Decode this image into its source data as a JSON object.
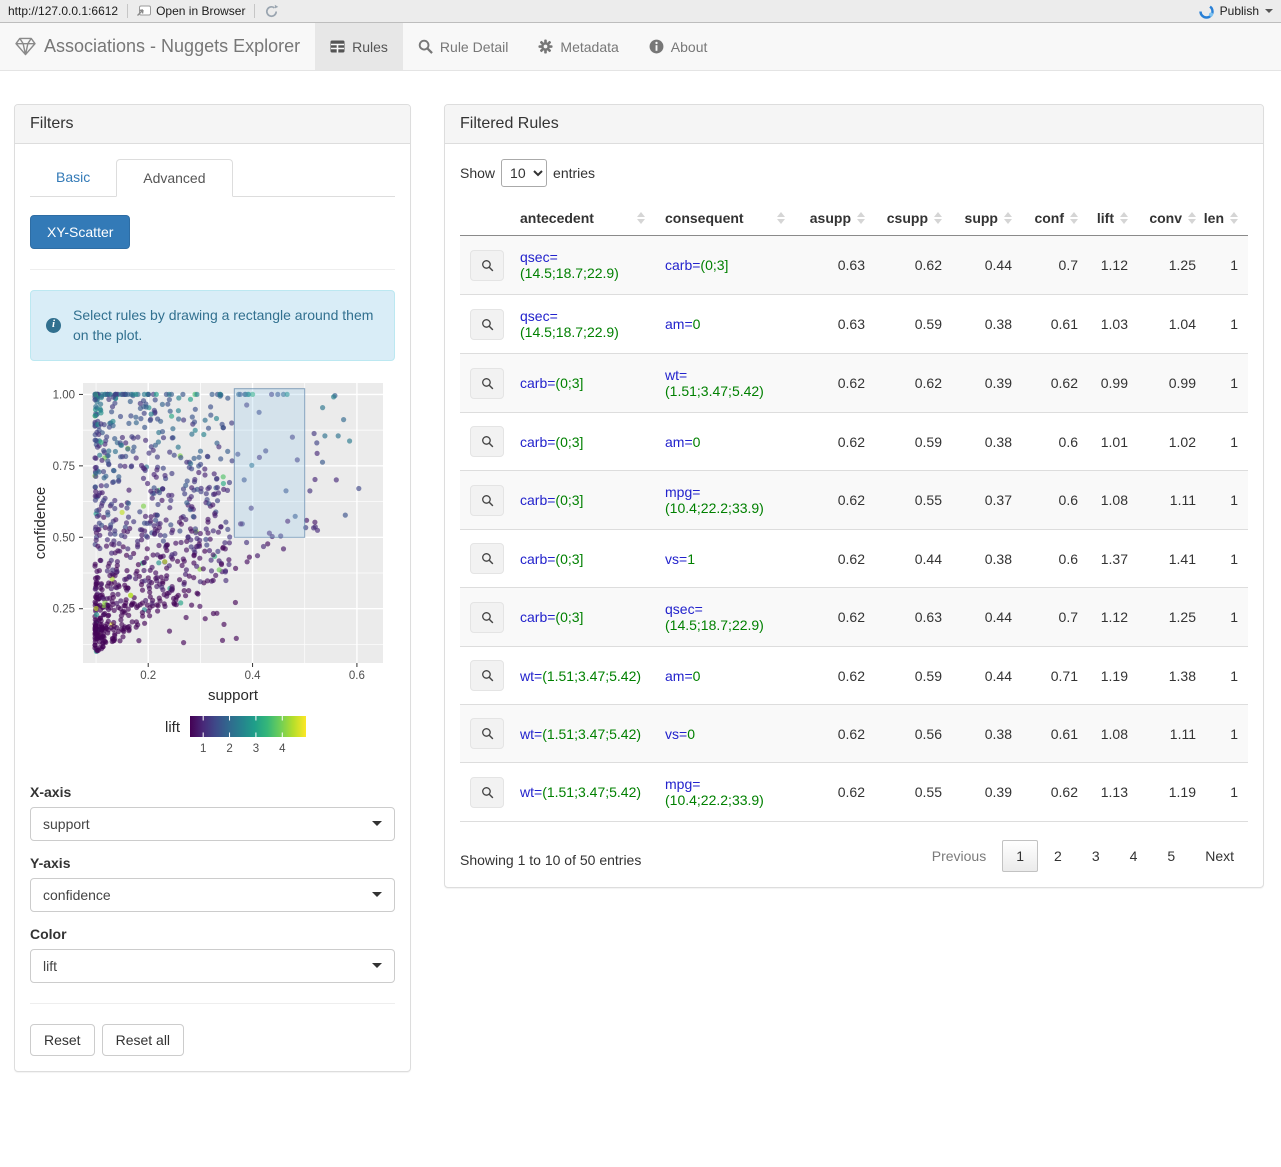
{
  "viewer_toolbar": {
    "url": "http://127.0.0.1:6612",
    "open_in_browser_label": "Open in Browser",
    "publish_label": "Publish"
  },
  "navbar": {
    "brand": "Associations - Nuggets Explorer",
    "tabs": [
      {
        "label": "Rules",
        "icon": "table-icon",
        "active": true
      },
      {
        "label": "Rule Detail",
        "icon": "search-icon",
        "active": false
      },
      {
        "label": "Metadata",
        "icon": "gear-icon",
        "active": false
      },
      {
        "label": "About",
        "icon": "info-icon",
        "active": false
      }
    ]
  },
  "filters_panel": {
    "title": "Filters",
    "tabs": [
      {
        "label": "Basic",
        "active": false
      },
      {
        "label": "Advanced",
        "active": true
      }
    ],
    "scatter_button_label": "XY-Scatter",
    "info_alert": "Select rules by drawing a rectangle around them on the plot.",
    "x_axis": {
      "label": "X-axis",
      "value": "support"
    },
    "y_axis": {
      "label": "Y-axis",
      "value": "confidence"
    },
    "color": {
      "label": "Color",
      "value": "lift"
    },
    "reset_label": "Reset",
    "reset_all_label": "Reset all"
  },
  "rules_panel": {
    "title": "Filtered Rules",
    "show_label": "Show",
    "entries_label": "entries",
    "page_length": "10",
    "columns": [
      {
        "label": "",
        "sortable": false,
        "align": "left"
      },
      {
        "label": "antecedent",
        "sortable": true,
        "align": "left"
      },
      {
        "label": "consequent",
        "sortable": true,
        "align": "left"
      },
      {
        "label": "asupp",
        "sortable": true,
        "align": "right"
      },
      {
        "label": "csupp",
        "sortable": true,
        "align": "right"
      },
      {
        "label": "supp",
        "sortable": true,
        "align": "right"
      },
      {
        "label": "conf",
        "sortable": true,
        "align": "right"
      },
      {
        "label": "lift",
        "sortable": true,
        "align": "right"
      },
      {
        "label": "conv",
        "sortable": true,
        "align": "right"
      },
      {
        "label": "len",
        "sortable": true,
        "align": "right"
      }
    ],
    "rows": [
      {
        "antecedent": {
          "attr": "qsec=",
          "value": "(14.5;18.7;22.9)"
        },
        "consequent": {
          "attr": "carb=",
          "value": "(0;3]"
        },
        "asupp": "0.63",
        "csupp": "0.62",
        "supp": "0.44",
        "conf": "0.7",
        "lift": "1.12",
        "conv": "1.25",
        "len": "1"
      },
      {
        "antecedent": {
          "attr": "qsec=",
          "value": "(14.5;18.7;22.9)"
        },
        "consequent": {
          "attr": "am=",
          "value": "0"
        },
        "asupp": "0.63",
        "csupp": "0.59",
        "supp": "0.38",
        "conf": "0.61",
        "lift": "1.03",
        "conv": "1.04",
        "len": "1"
      },
      {
        "antecedent": {
          "attr": "carb=",
          "value": "(0;3]"
        },
        "consequent": {
          "attr": "wt=",
          "value": "(1.51;3.47;5.42)"
        },
        "asupp": "0.62",
        "csupp": "0.62",
        "supp": "0.39",
        "conf": "0.62",
        "lift": "0.99",
        "conv": "0.99",
        "len": "1"
      },
      {
        "antecedent": {
          "attr": "carb=",
          "value": "(0;3]"
        },
        "consequent": {
          "attr": "am=",
          "value": "0"
        },
        "asupp": "0.62",
        "csupp": "0.59",
        "supp": "0.38",
        "conf": "0.6",
        "lift": "1.01",
        "conv": "1.02",
        "len": "1"
      },
      {
        "antecedent": {
          "attr": "carb=",
          "value": "(0;3]"
        },
        "consequent": {
          "attr": "mpg=",
          "value": "(10.4;22.2;33.9)"
        },
        "asupp": "0.62",
        "csupp": "0.55",
        "supp": "0.37",
        "conf": "0.6",
        "lift": "1.08",
        "conv": "1.11",
        "len": "1"
      },
      {
        "antecedent": {
          "attr": "carb=",
          "value": "(0;3]"
        },
        "consequent": {
          "attr": "vs=",
          "value": "1"
        },
        "asupp": "0.62",
        "csupp": "0.44",
        "supp": "0.38",
        "conf": "0.6",
        "lift": "1.37",
        "conv": "1.41",
        "len": "1"
      },
      {
        "antecedent": {
          "attr": "carb=",
          "value": "(0;3]"
        },
        "consequent": {
          "attr": "qsec=",
          "value": "(14.5;18.7;22.9)"
        },
        "asupp": "0.62",
        "csupp": "0.63",
        "supp": "0.44",
        "conf": "0.7",
        "lift": "1.12",
        "conv": "1.25",
        "len": "1"
      },
      {
        "antecedent": {
          "attr": "wt=",
          "value": "(1.51;3.47;5.42)"
        },
        "consequent": {
          "attr": "am=",
          "value": "0"
        },
        "asupp": "0.62",
        "csupp": "0.59",
        "supp": "0.44",
        "conf": "0.71",
        "lift": "1.19",
        "conv": "1.38",
        "len": "1"
      },
      {
        "antecedent": {
          "attr": "wt=",
          "value": "(1.51;3.47;5.42)"
        },
        "consequent": {
          "attr": "vs=",
          "value": "0"
        },
        "asupp": "0.62",
        "csupp": "0.56",
        "supp": "0.38",
        "conf": "0.61",
        "lift": "1.08",
        "conv": "1.11",
        "len": "1"
      },
      {
        "antecedent": {
          "attr": "wt=",
          "value": "(1.51;3.47;5.42)"
        },
        "consequent": {
          "attr": "mpg=",
          "value": "(10.4;22.2;33.9)"
        },
        "asupp": "0.62",
        "csupp": "0.55",
        "supp": "0.39",
        "conf": "0.62",
        "lift": "1.13",
        "conv": "1.19",
        "len": "1"
      }
    ],
    "info": "Showing 1 to 10 of 50 entries",
    "pagination": {
      "previous": "Previous",
      "pages": [
        "1",
        "2",
        "3",
        "4",
        "5"
      ],
      "active_page": "1",
      "next": "Next"
    }
  },
  "chart_data": {
    "type": "scatter",
    "xlabel": "support",
    "ylabel": "confidence",
    "x_ticks": [
      0.2,
      0.4,
      0.6
    ],
    "x_minor": [
      0.1,
      0.3,
      0.5
    ],
    "y_ticks": [
      0.25,
      0.5,
      0.75,
      1.0
    ],
    "y_tick_labels": [
      "0.25",
      "0.50",
      "0.75",
      "1.00"
    ],
    "y_minor": [
      0.125,
      0.375,
      0.625,
      0.875
    ],
    "xlim": [
      0.075,
      0.65
    ],
    "ylim": [
      0.06,
      1.04
    ],
    "grid": true,
    "panel_background": "#ebebeb",
    "gridline_color": "#ffffff",
    "color_legend": {
      "label": "lift",
      "ticks": [
        "1",
        "2",
        "3",
        "4"
      ],
      "tick_values": [
        1,
        2,
        3,
        4
      ],
      "scale": "viridis",
      "domain": [
        0.5,
        4.9
      ],
      "position": "bottom"
    },
    "viridis_stops": [
      "#440154",
      "#482878",
      "#3e4a89",
      "#31688e",
      "#26828e",
      "#1f9e89",
      "#35b779",
      "#6ece58",
      "#b5de2b",
      "#fde725"
    ],
    "selection_rect": {
      "x0": 0.365,
      "x1": 0.5,
      "y0": 0.5,
      "y1": 1.02,
      "fill": "#99ccee",
      "stroke": "#5b82a6"
    },
    "point_cloud": {
      "seed": 42,
      "n": 950,
      "marker_radius": 2.6,
      "opacity": 0.65,
      "note": "dense triangular cloud of 5000+ rules, support mostly 0.1-0.35, confidence between support and 1.0, colored by lift (mostly 1-2, few up to 4+)"
    }
  },
  "colors": {
    "accent": "#337ab7",
    "attr_blue": "#2222cc",
    "value_green": "#008000",
    "alert_bg": "#d9edf7",
    "alert_text": "#31708f",
    "publish_blue": "#2980d6"
  }
}
